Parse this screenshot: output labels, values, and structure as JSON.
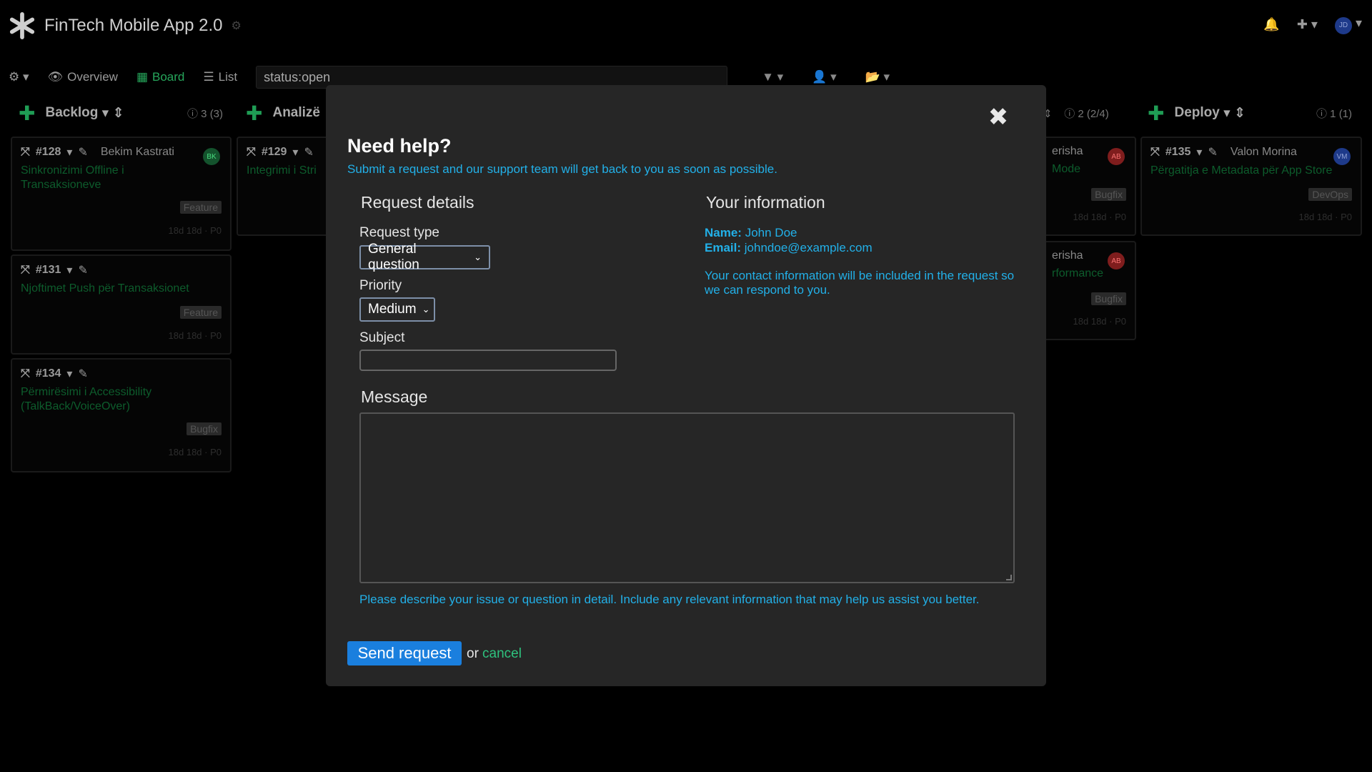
{
  "app": {
    "title": "FinTech Mobile App 2.0"
  },
  "toolbar": {
    "overview_label": "Overview",
    "board_label": "Board",
    "list_label": "List",
    "filter_value": "status:open"
  },
  "columns": [
    {
      "name": "Backlog",
      "count": "3",
      "count_detail": "(3)"
    },
    {
      "name": "Analizë",
      "count": "",
      "count_detail": ""
    },
    {
      "name": "",
      "count": "2",
      "count_detail": "(2/4)"
    },
    {
      "name": "Deploy",
      "count": "1",
      "count_detail": "(1)"
    }
  ],
  "cards": [
    {
      "id": "#128",
      "assignee": "Bekim Kastrati",
      "avatar": "BK",
      "avatar_color": "#14532d",
      "title": "Sinkronizimi Offline i Transaksioneve",
      "tag": "Feature",
      "meta": "18d 18d · P0"
    },
    {
      "id": "#131",
      "assignee": "",
      "avatar": "",
      "avatar_color": "",
      "title": "Njoftimet Push për Transaksionet",
      "tag": "Feature",
      "meta": "18d 18d · P0"
    },
    {
      "id": "#134",
      "assignee": "",
      "avatar": "",
      "avatar_color": "",
      "title": "Përmirësimi i Accessibility (TalkBack/VoiceOver)",
      "tag": "Bugfix",
      "meta": "18d 18d · P0"
    },
    {
      "id": "#129",
      "assignee": "",
      "avatar": "",
      "avatar_color": "",
      "title": "Integrimi i Stri",
      "tag": "",
      "meta": ""
    },
    {
      "id": "",
      "assignee": "erisha",
      "avatar": "AB",
      "avatar_color": "#7f1d1d",
      "title": "Mode",
      "tag": "Bugfix",
      "meta": "18d 18d · P0"
    },
    {
      "id": "",
      "assignee": "erisha",
      "avatar": "AB",
      "avatar_color": "#7f1d1d",
      "title": "rformance",
      "tag": "Bugfix",
      "meta": "18d 18d · P0"
    },
    {
      "id": "#135",
      "assignee": "Valon Morina",
      "avatar": "VM",
      "avatar_color": "#1e3a8a",
      "title": "Përgatitja e Metadata për App Store",
      "tag": "DevOps",
      "meta": "18d 18d · P0"
    }
  ],
  "user_avatar": "JD",
  "modal": {
    "title": "Need help?",
    "subtitle": "Submit a request and our support team will get back to you as soon as possible.",
    "request_details_heading": "Request details",
    "your_info_heading": "Your information",
    "request_type_label": "Request type",
    "request_type_value": "General question",
    "priority_label": "Priority",
    "priority_value": "Medium",
    "subject_label": "Subject",
    "subject_value": "",
    "message_heading": "Message",
    "message_value": "",
    "message_help": "Please describe your issue or question in detail. Include any relevant information that may help us assist you better.",
    "name_label": "Name:",
    "name_value": "John Doe",
    "email_label": "Email:",
    "email_value": "johndoe@example.com",
    "contact_note": "Your contact information will be included in the request so we can respond to you.",
    "send_label": "Send request",
    "or_label": "or",
    "cancel_label": "cancel"
  },
  "colors": {
    "accent": "#22b0e8",
    "primary_button": "#1a7fde",
    "cancel_link": "#2ec27e",
    "modal_bg": "#262626"
  }
}
